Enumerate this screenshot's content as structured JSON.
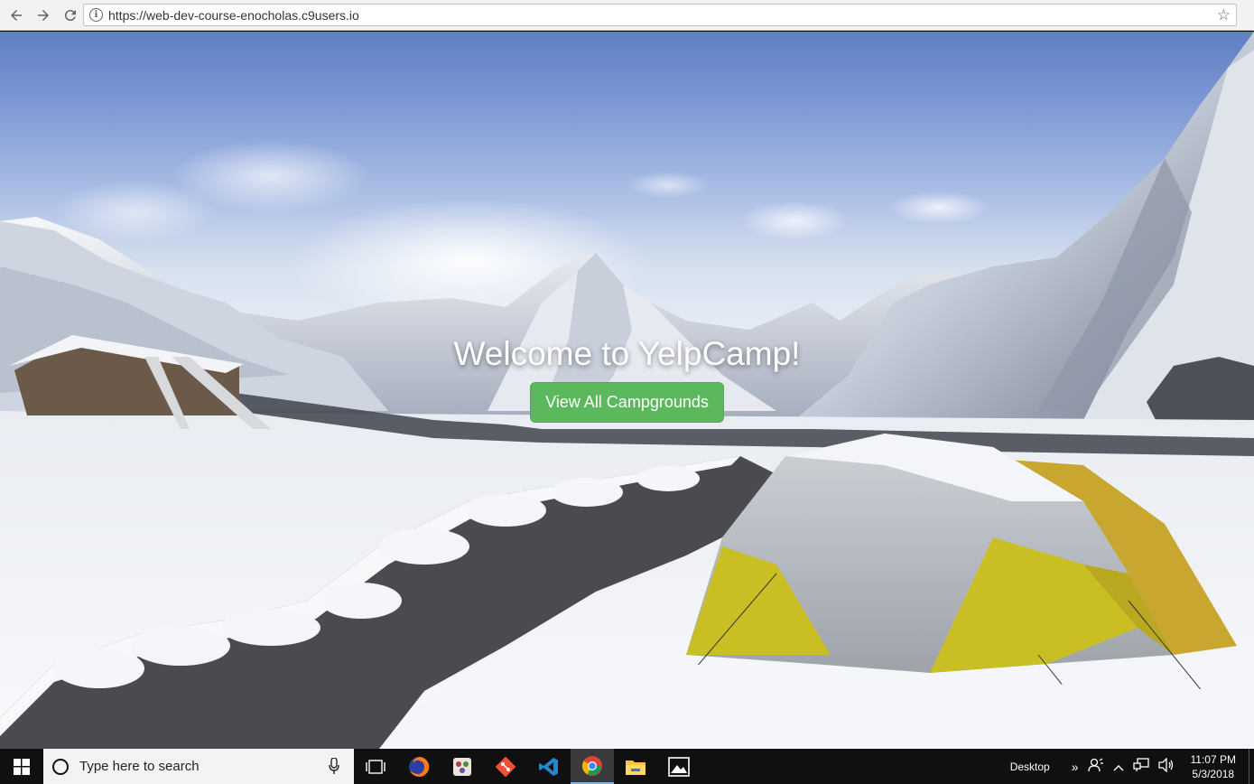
{
  "browser": {
    "url": "https://web-dev-course-enocholas.c9users.io",
    "back_icon": "arrow-left-icon",
    "forward_icon": "arrow-right-icon",
    "reload_icon": "reload-icon",
    "info_icon": "info-icon",
    "bookmark_icon": "star-icon"
  },
  "hero": {
    "title": "Welcome to YelpCamp!",
    "button_label": "View All Campgrounds",
    "button_color": "#5cb85c"
  },
  "taskbar": {
    "search_placeholder": "Type here to search",
    "apps": [
      "task-view-icon",
      "firefox-icon",
      "game-icon",
      "git-icon",
      "vscode-icon",
      "chrome-icon",
      "file-explorer-icon",
      "photos-icon"
    ],
    "tray_label": "Desktop",
    "time": "11:07 PM",
    "date": "5/3/2018"
  }
}
